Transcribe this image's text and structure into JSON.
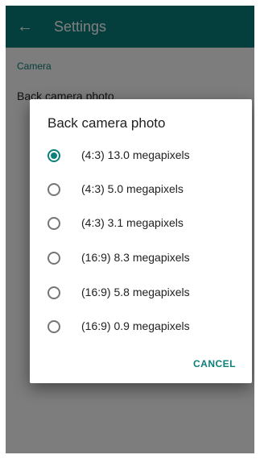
{
  "toolbar": {
    "title": "Settings"
  },
  "settings_bg": {
    "category": "Camera",
    "items": [
      {
        "title": "Back camera photo",
        "summary": ""
      },
      {
        "title": "",
        "summary": ""
      },
      {
        "title": "",
        "summary": ""
      },
      {
        "title": "",
        "summary": ""
      },
      {
        "title": "",
        "summary": ""
      }
    ]
  },
  "dialog": {
    "title": "Back camera photo",
    "options": [
      {
        "label": "(4:3) 13.0 megapixels",
        "checked": true
      },
      {
        "label": "(4:3) 5.0 megapixels",
        "checked": false
      },
      {
        "label": "(4:3) 3.1 megapixels",
        "checked": false
      },
      {
        "label": "(16:9) 8.3 megapixels",
        "checked": false
      },
      {
        "label": "(16:9) 5.8 megapixels",
        "checked": false
      },
      {
        "label": "(16:9) 0.9 megapixels",
        "checked": false
      }
    ],
    "cancel_label": "CANCEL"
  },
  "colors": {
    "accent": "#0b7f7a",
    "toolbar": "#0b7f7a",
    "scrim": "rgba(0,0,0,0.5)"
  }
}
